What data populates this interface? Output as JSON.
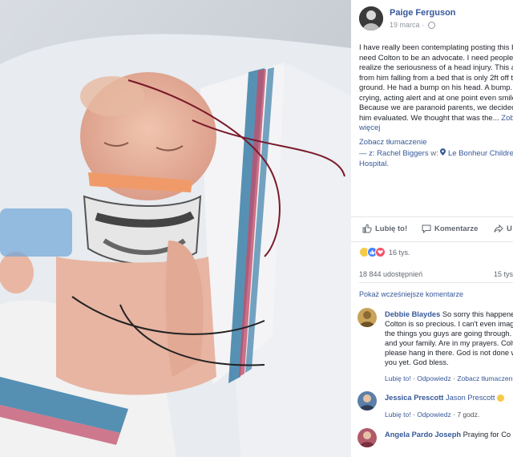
{
  "post": {
    "author": "Paige Ferguson",
    "date": "19 marca",
    "date_sep": "·",
    "text": "I have really been contemplating posting this but I need Colton to be an advocate. I need people to realize the seriousness of a head injury. This all came from him falling from a bed that is only 2ft off the ground. He had a bump on his head. A bump. He was crying, acting alert and at one point even smiled. Because we are paranoid parents, we decided to get him evaluated. We thought that was the...",
    "see_more": "Zobacz więcej",
    "translate": "Zobacz tłumaczenie",
    "with_prefix": "— z:",
    "with_name": "Rachel Biggers",
    "with_at": "w:",
    "place": "Le Bonheur Children's Hospital."
  },
  "actions": {
    "like": "Lubię to!",
    "comment": "Komentarze",
    "share": "U"
  },
  "stats": {
    "reactions": "16 tys.",
    "shares": "18 844 udostępnień",
    "comments": "15 tys."
  },
  "comments": {
    "more_label": "Pokaż wcześniejsze komentarze",
    "items": [
      {
        "name": "Debbie Blaydes",
        "text": "So sorry this happened. Colton is so precious. I can't even imagine the things you guys are going through. You and your family. Are in my prayers. Colton please hang in there. God is not done with you yet. God bless.",
        "like": "Lubię to!",
        "reply": "Odpowiedz",
        "translate": "Zobacz tłumaczenie",
        "sep": "·"
      },
      {
        "name": "Jessica Prescott",
        "text": "Jason Prescott",
        "like": "Lubię to!",
        "reply": "Odpowiedz",
        "time": "7 godz.",
        "sep": "·"
      },
      {
        "name": "Angela Pardo Joseph",
        "text": "Praying for Co"
      }
    ]
  },
  "colors": {
    "link": "#365899",
    "text": "#1d2129",
    "muted": "#90949c",
    "like_blue": "#4080ff",
    "love_red": "#f25268",
    "sad_yellow": "#f7c948"
  }
}
